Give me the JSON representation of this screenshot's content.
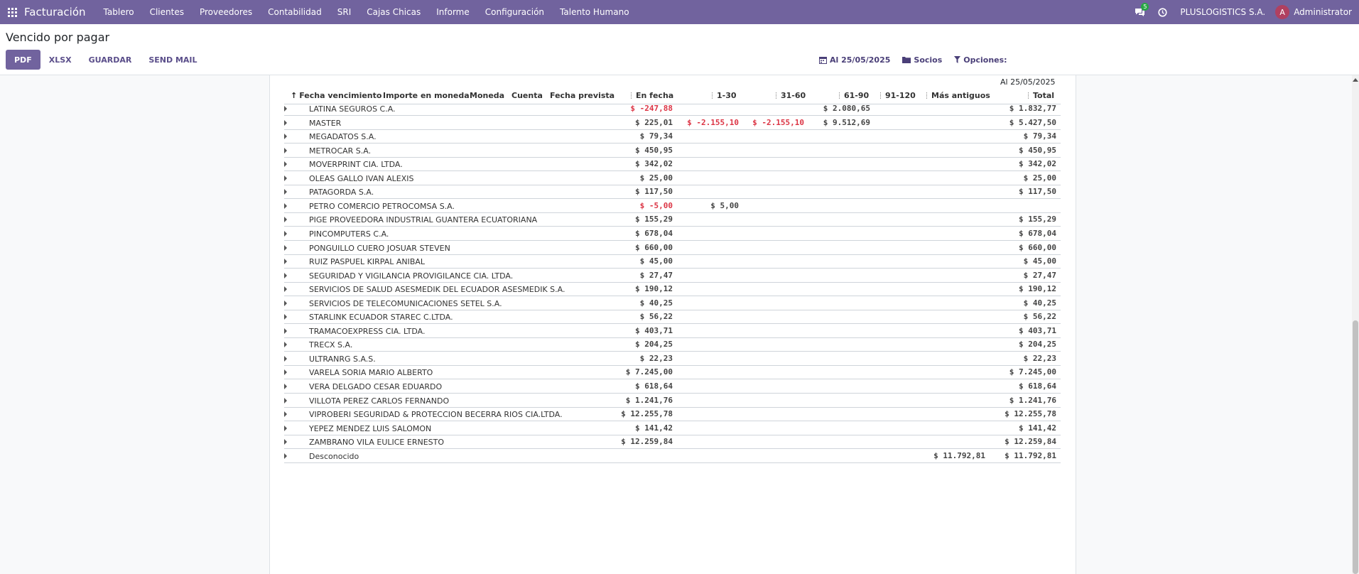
{
  "app": {
    "brand": "Facturación",
    "menu": [
      "Tablero",
      "Clientes",
      "Proveedores",
      "Contabilidad",
      "SRI",
      "Cajas Chicas",
      "Informe",
      "Configuración",
      "Talento Humano"
    ],
    "chat_count": "5",
    "company": "PLUSLOGISTICS S.A.",
    "user_initial": "A",
    "user_name": "Administrator"
  },
  "page": {
    "title": "Vencido por pagar",
    "buttons": {
      "pdf": "PDF",
      "xlsx": "XLSX",
      "save": "GUARDAR",
      "send_mail": "SEND MAIL"
    },
    "filters": {
      "date": "Al 25/05/2025",
      "partners": "Socios",
      "options": "Opciones:"
    }
  },
  "report": {
    "date_header": "Al 25/05/2025",
    "columns": {
      "due_date": "Fecha vencimiento",
      "amount_currency": "Importe en moneda",
      "currency": "Moneda",
      "account": "Cuenta",
      "expected_date": "Fecha prevista",
      "en_fecha": "En fecha",
      "c1_30": "1-30",
      "c31_60": "31-60",
      "c61_90": "61-90",
      "c91_120": "91-120",
      "mas": "Más antiguos",
      "total": "Total"
    },
    "rows": [
      {
        "partner": "LATINA SEGUROS C.A.",
        "en_fecha": "$ -247,88",
        "c1_30": "",
        "c31_60": "",
        "c61_90": "$ 2.080,65",
        "c91_120": "",
        "mas": "",
        "total": "$ 1.832,77"
      },
      {
        "partner": "MASTER",
        "en_fecha": "$ 225,01",
        "c1_30": "$ -2.155,10",
        "c31_60": "$ -2.155,10",
        "c61_90": "$ 9.512,69",
        "c91_120": "",
        "mas": "",
        "total": "$ 5.427,50"
      },
      {
        "partner": "MEGADATOS S.A.",
        "en_fecha": "$ 79,34",
        "c1_30": "",
        "c31_60": "",
        "c61_90": "",
        "c91_120": "",
        "mas": "",
        "total": "$ 79,34"
      },
      {
        "partner": "METROCAR S.A.",
        "en_fecha": "$ 450,95",
        "c1_30": "",
        "c31_60": "",
        "c61_90": "",
        "c91_120": "",
        "mas": "",
        "total": "$ 450,95"
      },
      {
        "partner": "MOVERPRINT CIA. LTDA.",
        "en_fecha": "$ 342,02",
        "c1_30": "",
        "c31_60": "",
        "c61_90": "",
        "c91_120": "",
        "mas": "",
        "total": "$ 342,02"
      },
      {
        "partner": "OLEAS GALLO IVAN ALEXIS",
        "en_fecha": "$ 25,00",
        "c1_30": "",
        "c31_60": "",
        "c61_90": "",
        "c91_120": "",
        "mas": "",
        "total": "$ 25,00"
      },
      {
        "partner": "PATAGORDA S.A.",
        "en_fecha": "$ 117,50",
        "c1_30": "",
        "c31_60": "",
        "c61_90": "",
        "c91_120": "",
        "mas": "",
        "total": "$ 117,50"
      },
      {
        "partner": "PETRO COMERCIO PETROCOMSA S.A.",
        "en_fecha": "$ -5,00",
        "c1_30": "$ 5,00",
        "c31_60": "",
        "c61_90": "",
        "c91_120": "",
        "mas": "",
        "total": ""
      },
      {
        "partner": "PIGE PROVEEDORA INDUSTRIAL GUANTERA ECUATORIANA",
        "en_fecha": "$ 155,29",
        "c1_30": "",
        "c31_60": "",
        "c61_90": "",
        "c91_120": "",
        "mas": "",
        "total": "$ 155,29"
      },
      {
        "partner": "PINCOMPUTERS C.A.",
        "en_fecha": "$ 678,04",
        "c1_30": "",
        "c31_60": "",
        "c61_90": "",
        "c91_120": "",
        "mas": "",
        "total": "$ 678,04"
      },
      {
        "partner": "PONGUILLO CUERO JOSUAR STEVEN",
        "en_fecha": "$ 660,00",
        "c1_30": "",
        "c31_60": "",
        "c61_90": "",
        "c91_120": "",
        "mas": "",
        "total": "$ 660,00"
      },
      {
        "partner": "RUIZ PASPUEL KIRPAL ANIBAL",
        "en_fecha": "$ 45,00",
        "c1_30": "",
        "c31_60": "",
        "c61_90": "",
        "c91_120": "",
        "mas": "",
        "total": "$ 45,00"
      },
      {
        "partner": "SEGURIDAD Y VIGILANCIA PROVIGILANCE CIA. LTDA.",
        "en_fecha": "$ 27,47",
        "c1_30": "",
        "c31_60": "",
        "c61_90": "",
        "c91_120": "",
        "mas": "",
        "total": "$ 27,47"
      },
      {
        "partner": "SERVICIOS DE SALUD ASESMEDIK DEL ECUADOR ASESMEDIK S.A.",
        "en_fecha": "$ 190,12",
        "c1_30": "",
        "c31_60": "",
        "c61_90": "",
        "c91_120": "",
        "mas": "",
        "total": "$ 190,12"
      },
      {
        "partner": "SERVICIOS DE TELECOMUNICACIONES SETEL S.A.",
        "en_fecha": "$ 40,25",
        "c1_30": "",
        "c31_60": "",
        "c61_90": "",
        "c91_120": "",
        "mas": "",
        "total": "$ 40,25"
      },
      {
        "partner": "STARLINK ECUADOR STAREC C.LTDA.",
        "en_fecha": "$ 56,22",
        "c1_30": "",
        "c31_60": "",
        "c61_90": "",
        "c91_120": "",
        "mas": "",
        "total": "$ 56,22"
      },
      {
        "partner": "TRAMACOEXPRESS CIA. LTDA.",
        "en_fecha": "$ 403,71",
        "c1_30": "",
        "c31_60": "",
        "c61_90": "",
        "c91_120": "",
        "mas": "",
        "total": "$ 403,71"
      },
      {
        "partner": "TRECX S.A.",
        "en_fecha": "$ 204,25",
        "c1_30": "",
        "c31_60": "",
        "c61_90": "",
        "c91_120": "",
        "mas": "",
        "total": "$ 204,25"
      },
      {
        "partner": "ULTRANRG S.A.S.",
        "en_fecha": "$ 22,23",
        "c1_30": "",
        "c31_60": "",
        "c61_90": "",
        "c91_120": "",
        "mas": "",
        "total": "$ 22,23"
      },
      {
        "partner": "VARELA SORIA MARIO ALBERTO",
        "en_fecha": "$ 7.245,00",
        "c1_30": "",
        "c31_60": "",
        "c61_90": "",
        "c91_120": "",
        "mas": "",
        "total": "$ 7.245,00"
      },
      {
        "partner": "VERA DELGADO CESAR EDUARDO",
        "en_fecha": "$ 618,64",
        "c1_30": "",
        "c31_60": "",
        "c61_90": "",
        "c91_120": "",
        "mas": "",
        "total": "$ 618,64"
      },
      {
        "partner": "VILLOTA PEREZ CARLOS FERNANDO",
        "en_fecha": "$ 1.241,76",
        "c1_30": "",
        "c31_60": "",
        "c61_90": "",
        "c91_120": "",
        "mas": "",
        "total": "$ 1.241,76"
      },
      {
        "partner": "VIPROBERI SEGURIDAD & PROTECCION BECERRA RIOS CIA.LTDA.",
        "en_fecha": "$ 12.255,78",
        "c1_30": "",
        "c31_60": "",
        "c61_90": "",
        "c91_120": "",
        "mas": "",
        "total": "$ 12.255,78"
      },
      {
        "partner": "YEPEZ MENDEZ LUIS SALOMON",
        "en_fecha": "$ 141,42",
        "c1_30": "",
        "c31_60": "",
        "c61_90": "",
        "c91_120": "",
        "mas": "",
        "total": "$ 141,42"
      },
      {
        "partner": "ZAMBRANO VILA EULICE ERNESTO",
        "en_fecha": "$ 12.259,84",
        "c1_30": "",
        "c31_60": "",
        "c61_90": "",
        "c91_120": "",
        "mas": "",
        "total": "$ 12.259,84"
      },
      {
        "partner": "Desconocido",
        "en_fecha": "",
        "c1_30": "",
        "c31_60": "",
        "c61_90": "",
        "c91_120": "",
        "mas": "$ 11.792,81",
        "total": "$ 11.792,81"
      }
    ]
  },
  "colors": {
    "topbar": "#71639e",
    "primary": "#71639e",
    "negative": "#dc3545",
    "badge": "#28a745"
  }
}
